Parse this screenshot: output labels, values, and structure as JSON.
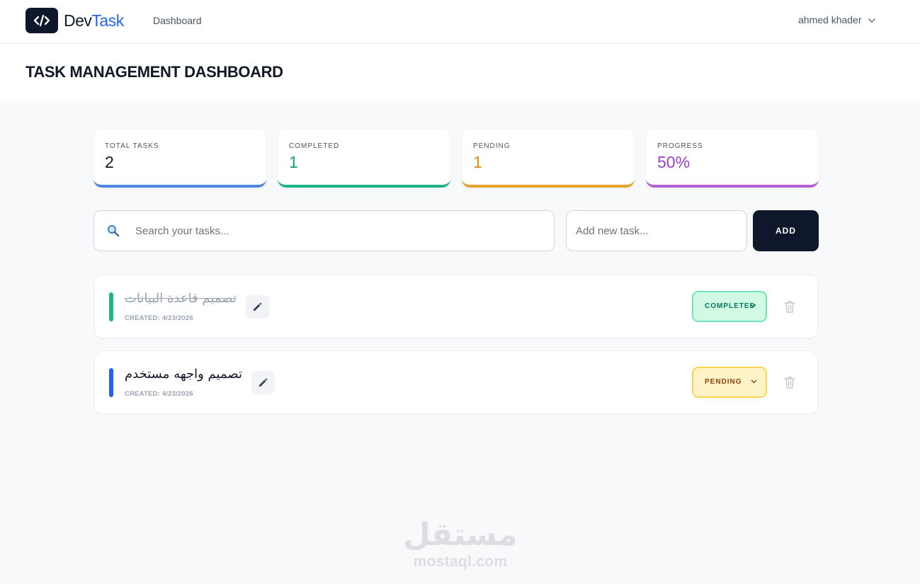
{
  "navbar": {
    "brand_part1": "Dev",
    "brand_part2": "Task",
    "nav_link": "Dashboard",
    "user_name": "ahmed khader"
  },
  "header": {
    "title": "TASK MANAGEMENT DASHBOARD"
  },
  "stats": [
    {
      "label": "TOTAL TASKS",
      "value": "2",
      "color": "#3b82f6"
    },
    {
      "label": "COMPLETED",
      "value": "1",
      "color": "#10b981"
    },
    {
      "label": "PENDING",
      "value": "1",
      "color": "#f59e0b"
    },
    {
      "label": "PROGRESS",
      "value": "50%",
      "color": "#a855f7"
    }
  ],
  "search": {
    "placeholder": "Search your tasks...",
    "icon": "search-icon"
  },
  "add_task": {
    "placeholder": "Add new task...",
    "button_label": "ADD"
  },
  "tasks": [
    {
      "title": "تصميم قاعدة البيانات",
      "created": "CREATED: 4/23/2026",
      "status": "COMPLETED",
      "accent": "#10b981"
    },
    {
      "title": "تصميم واجهه مستخدم",
      "created": "CREATED: 4/23/2026",
      "status": "PENDING",
      "accent": "#2563eb"
    }
  ],
  "watermark": {
    "arabic": "مستقل",
    "latin": "mostaql.com"
  }
}
